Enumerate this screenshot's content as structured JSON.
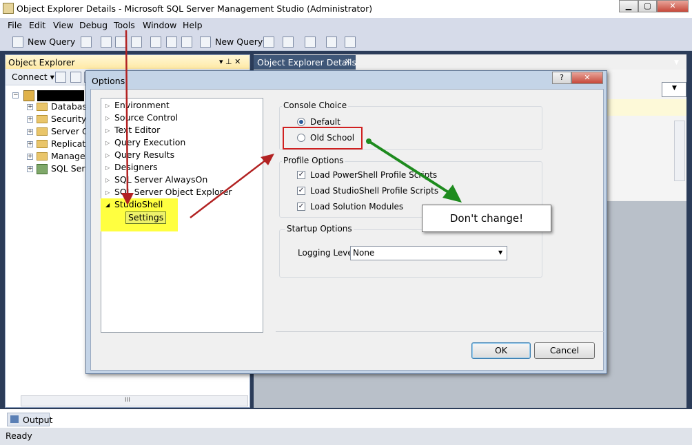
{
  "window": {
    "title": "Object Explorer Details - Microsoft SQL Server Management Studio (Administrator)",
    "min_label": "▁",
    "max_label": "▢",
    "close_label": "✕"
  },
  "menu": [
    "File",
    "Edit",
    "View",
    "Debug",
    "Tools",
    "Window",
    "Help"
  ],
  "toolbar": {
    "new_query_1": "New Query",
    "new_query_2": "New Query"
  },
  "object_explorer": {
    "title": "Object Explorer",
    "pin": "▾ ⊥ ✕",
    "connect": "Connect ▾",
    "nodes": [
      "Databases",
      "Security",
      "Server Ob",
      "Replicatio",
      "Managem",
      "SQL Serve"
    ],
    "scroll_label": "III"
  },
  "doc_tab": {
    "label": "Object Explorer Details",
    "close": "✕"
  },
  "output_tab": "Output",
  "status": "Ready",
  "dialog": {
    "title": "Options",
    "help": "?",
    "close": "✕",
    "tree": [
      {
        "label": "Environment"
      },
      {
        "label": "Source Control"
      },
      {
        "label": "Text Editor"
      },
      {
        "label": "Query Execution"
      },
      {
        "label": "Query Results"
      },
      {
        "label": "Designers"
      },
      {
        "label": "SQL Server AlwaysOn"
      },
      {
        "label": "SQL Server Object Explorer"
      },
      {
        "label": "StudioShell"
      }
    ],
    "selected_child": "Settings",
    "console_choice": {
      "label": "Console Choice",
      "default": "Default",
      "old_school": "Old School"
    },
    "profile_options": {
      "label": "Profile Options",
      "items": [
        "Load PowerShell Profile Scripts",
        "Load StudioShell Profile Scripts",
        "Load Solution Modules"
      ]
    },
    "startup_options": {
      "label": "Startup Options",
      "logging_label": "Logging Level:",
      "logging_value": "None"
    },
    "ok": "OK",
    "cancel": "Cancel"
  },
  "annotation": {
    "callout": "Don't change!"
  },
  "colors": {
    "highlight": "#ffff40",
    "red_arrow": "#b22222",
    "green_arrow": "#1e8b1e"
  }
}
